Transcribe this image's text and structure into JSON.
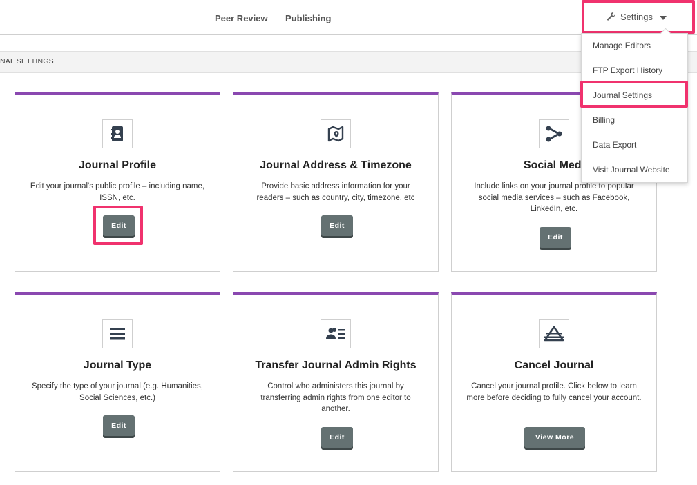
{
  "topbar": {
    "nav": [
      "Peer Review",
      "Publishing"
    ],
    "settings_label": "Settings"
  },
  "subbar": {
    "label": "NAL SETTINGS"
  },
  "dropdown": {
    "items": [
      "Manage Editors",
      "FTP Export History",
      "Journal Settings",
      "Billing",
      "Data Export",
      "Visit Journal Website"
    ]
  },
  "cards": [
    {
      "title": "Journal Profile",
      "desc": "Edit your journal's public profile – including name, ISSN, etc.",
      "button": "Edit",
      "icon": "contact-book-icon"
    },
    {
      "title": "Journal Address & Timezone",
      "desc": "Provide basic address information for your readers – such as country, city, timezone, etc",
      "button": "Edit",
      "icon": "map-pin-icon"
    },
    {
      "title": "Social Medi",
      "desc": "Include links on your journal profile to popular social media services – such as Facebook, LinkedIn, etc.",
      "button": "Edit",
      "icon": "share-icon"
    },
    {
      "title": "Journal Type",
      "desc": "Specify the type of your journal (e.g. Humanities, Social Sciences, etc.)",
      "button": "Edit",
      "icon": "list-icon"
    },
    {
      "title": "Transfer Journal Admin Rights",
      "desc": "Control who administers this journal by transferring admin rights from one editor to another.",
      "button": "Edit",
      "icon": "users-list-icon"
    },
    {
      "title": "Cancel Journal",
      "desc": "Cancel your journal profile. Click below to learn more before deciding to fully cancel your account.",
      "button": "View More",
      "icon": "eject-icon"
    }
  ],
  "colors": {
    "accent": "#8a48b0",
    "highlight": "#f0326e",
    "button": "#647172"
  }
}
